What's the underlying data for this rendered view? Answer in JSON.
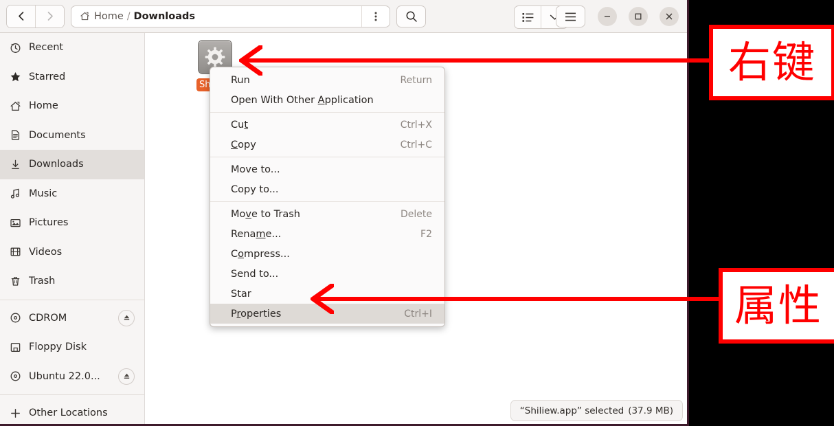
{
  "window": {
    "nav": {
      "back_icon": "chevron-left-icon",
      "forward_icon": "chevron-right-icon"
    },
    "path": {
      "home_icon": "home-icon",
      "home_label": "Home",
      "separator": "/",
      "current_label": "Downloads",
      "menu_icon": "vertical-dots-icon"
    },
    "search_icon": "search-icon",
    "view_list_icon": "list-view-icon",
    "view_chevron_icon": "chevron-down-icon",
    "hamburger_icon": "hamburger-menu-icon",
    "controls": {
      "minimize_icon": "minimize-icon",
      "maximize_icon": "maximize-icon",
      "close_icon": "close-icon"
    }
  },
  "sidebar": {
    "items": [
      {
        "label": "Recent",
        "icon": "clock-icon",
        "active": false,
        "eject": false
      },
      {
        "label": "Starred",
        "icon": "star-icon",
        "active": false,
        "eject": false
      },
      {
        "label": "Home",
        "icon": "home-icon",
        "active": false,
        "eject": false
      },
      {
        "label": "Documents",
        "icon": "document-icon",
        "active": false,
        "eject": false
      },
      {
        "label": "Downloads",
        "icon": "download-icon",
        "active": true,
        "eject": false
      },
      {
        "label": "Music",
        "icon": "music-icon",
        "active": false,
        "eject": false
      },
      {
        "label": "Pictures",
        "icon": "picture-icon",
        "active": false,
        "eject": false
      },
      {
        "label": "Videos",
        "icon": "video-icon",
        "active": false,
        "eject": false
      },
      {
        "label": "Trash",
        "icon": "trash-icon",
        "active": false,
        "eject": false
      },
      {
        "separator": true
      },
      {
        "label": "CDROM",
        "icon": "disc-icon",
        "active": false,
        "eject": true
      },
      {
        "label": "Floppy Disk",
        "icon": "floppy-icon",
        "active": false,
        "eject": false
      },
      {
        "label": "Ubuntu 22.0...",
        "icon": "disc-icon",
        "active": false,
        "eject": true
      },
      {
        "separator": true
      },
      {
        "label": "Other Locations",
        "icon": "plus-icon",
        "active": false,
        "eject": false
      }
    ]
  },
  "main": {
    "file": {
      "name": "Shiliew",
      "icon": "gear-executable-icon",
      "selected": true
    },
    "status": {
      "text": "“Shiliew.app” selected",
      "size": "(37.9 MB)"
    }
  },
  "context_menu": {
    "items": [
      {
        "label": "Run",
        "accel": "Return",
        "selected": false,
        "sep_after": false
      },
      {
        "label": "Open With Other Application",
        "accel": "",
        "selected": false,
        "sep_after": true
      },
      {
        "label": "Cut",
        "accel": "Ctrl+X",
        "selected": false,
        "sep_after": false
      },
      {
        "label": "Copy",
        "accel": "Ctrl+C",
        "selected": false,
        "sep_after": true
      },
      {
        "label": "Move to...",
        "accel": "",
        "selected": false,
        "sep_after": false
      },
      {
        "label": "Copy to...",
        "accel": "",
        "selected": false,
        "sep_after": true
      },
      {
        "label": "Move to Trash",
        "accel": "Delete",
        "selected": false,
        "sep_after": false
      },
      {
        "label": "Rename...",
        "accel": "F2",
        "selected": false,
        "sep_after": false
      },
      {
        "label": "Compress...",
        "accel": "",
        "selected": false,
        "sep_after": false
      },
      {
        "label": "Send to...",
        "accel": "",
        "selected": false,
        "sep_after": false
      },
      {
        "label": "Star",
        "accel": "",
        "selected": false,
        "sep_after": false
      },
      {
        "label": "Properties",
        "accel": "Ctrl+I",
        "selected": true,
        "sep_after": false
      }
    ]
  },
  "annotations": {
    "color": "#ff0000",
    "callouts": [
      {
        "text": "右键"
      },
      {
        "text": "属性"
      }
    ]
  }
}
